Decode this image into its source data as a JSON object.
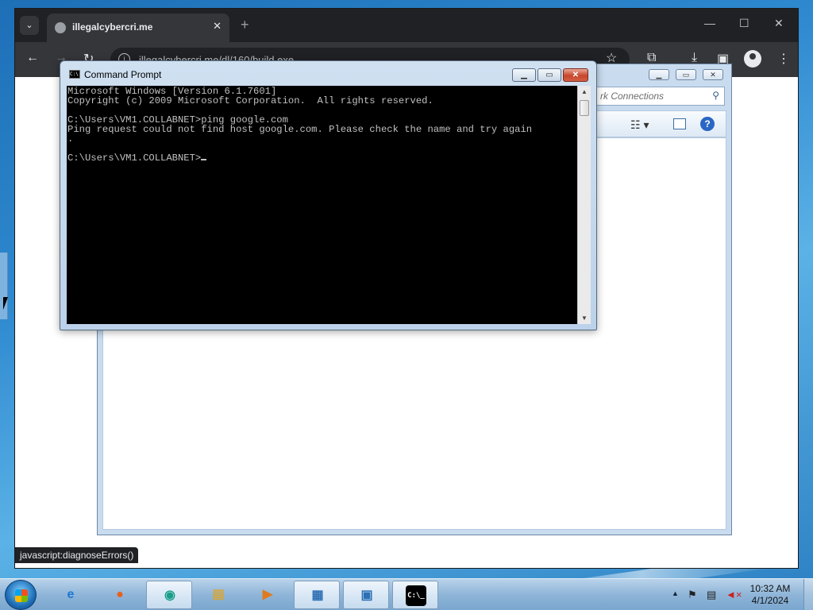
{
  "chrome": {
    "tab_title": "illegalcybercri.me",
    "tab_close": "✕",
    "new_tab": "+",
    "url": "illegalcybercri.me/dl/160/build.exe",
    "status_bubble": "javascript:diagnoseErrors()",
    "minimize": "—",
    "maximize": "☐",
    "close": "✕"
  },
  "explorer": {
    "search_placeholder": "rk Connections"
  },
  "cmd": {
    "title": "Command Prompt",
    "icon_text": "C:\\",
    "lines": [
      "Microsoft Windows [Version 6.1.7601]",
      "Copyright (c) 2009 Microsoft Corporation.  All rights reserved.",
      "",
      "C:\\Users\\VM1.COLLABNET>ping google.com",
      "Ping request could not find host google.com. Please check the name and try again",
      ".",
      "",
      "C:\\Users\\VM1.COLLABNET>"
    ]
  },
  "taskbar": {
    "items": [
      {
        "name": "internet-explorer",
        "glyph": "e",
        "color": "#1e78d2"
      },
      {
        "name": "firefox",
        "glyph": "●",
        "color": "#e8601c"
      },
      {
        "name": "edge",
        "glyph": "◉",
        "color": "#1a9e8c"
      },
      {
        "name": "file-explorer",
        "glyph": "▤",
        "color": "#d9a531"
      },
      {
        "name": "media-player",
        "glyph": "▶",
        "color": "#e07a1c"
      },
      {
        "name": "network-window",
        "glyph": "▦",
        "color": "#2d6fb4"
      },
      {
        "name": "control-panel",
        "glyph": "▣",
        "color": "#2d6fb4"
      },
      {
        "name": "command-prompt",
        "glyph": "C:\\_",
        "color": "#000000"
      }
    ],
    "time": "10:32 AM",
    "date": "4/1/2024"
  }
}
